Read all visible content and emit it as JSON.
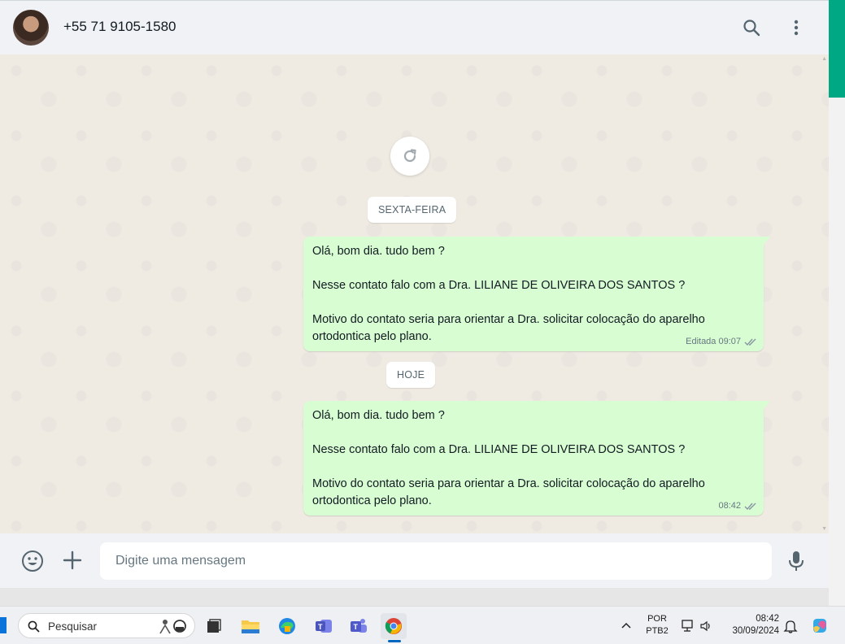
{
  "header": {
    "contact_name": "+55 71 9105-1580",
    "icons": [
      "avatar",
      "search-icon",
      "menu-icon"
    ]
  },
  "chat": {
    "date_chips": [
      "SEXTA-FEIRA",
      "HOJE"
    ],
    "messages": [
      {
        "lines": [
          "Olá, bom dia. tudo bem ?",
          "",
          "Nesse contato falo com a Dra. LILIANE DE OLIVEIRA DOS SANTOS ?",
          "",
          "Motivo do contato seria para orientar a Dra. solicitar colocação do aparelho",
          "ortodontica pelo plano."
        ],
        "time": "Editada 09:07",
        "status": "read"
      },
      {
        "lines": [
          "Olá, bom dia. tudo bem ?",
          "",
          "Nesse contato falo com a Dra. LILIANE DE OLIVEIRA DOS SANTOS ?",
          "",
          "Motivo do contato seria para orientar a Dra. solicitar colocação do aparelho",
          "ortodontica pelo plano."
        ],
        "time": "08:42",
        "status": "read"
      }
    ]
  },
  "composer": {
    "placeholder": "Digite uma mensagem"
  },
  "taskbar": {
    "search_label": "Pesquisar",
    "language_line1": "POR",
    "language_line2": "PTB2",
    "time": "08:42",
    "date": "30/09/2024",
    "apps": [
      "file-explorer-icon",
      "edge-icon",
      "teams-classic-icon",
      "teams-icon",
      "chrome-icon"
    ]
  },
  "colors": {
    "outgoing_bubble": "#d9fdd3",
    "chat_background": "#efeae2",
    "header_background": "#f0f2f5",
    "accent": "#00a884",
    "read_ticks": "#8696a0"
  }
}
